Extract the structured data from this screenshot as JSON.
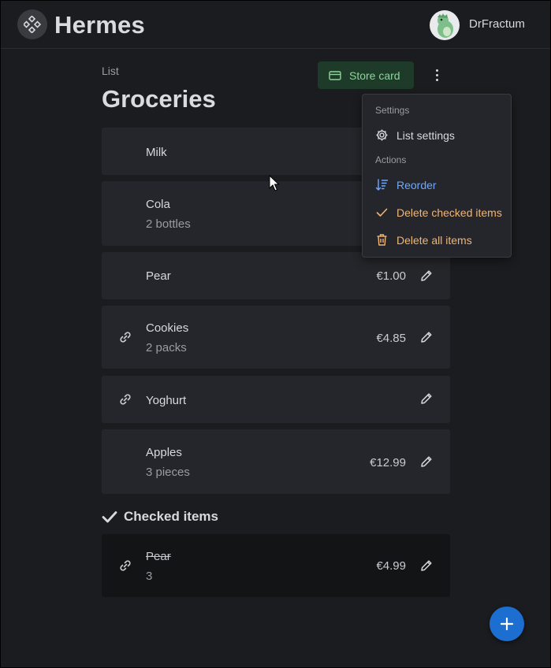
{
  "app": {
    "title": "Hermes",
    "username": "DrFractum"
  },
  "page": {
    "breadcrumb": "List",
    "title": "Groceries",
    "store_card_label": "Store card"
  },
  "menu": {
    "settings_header": "Settings",
    "list_settings": "List settings",
    "actions_header": "Actions",
    "reorder": "Reorder",
    "delete_checked": "Delete checked items",
    "delete_all": "Delete all items"
  },
  "items": [
    {
      "name": "Milk",
      "quantity": "",
      "price": "",
      "linked": false
    },
    {
      "name": "Cola",
      "quantity": "2 bottles",
      "price": "",
      "linked": false
    },
    {
      "name": "Pear",
      "quantity": "",
      "price": "€1.00",
      "linked": false
    },
    {
      "name": "Cookies",
      "quantity": "2 packs",
      "price": "€4.85",
      "linked": true
    },
    {
      "name": "Yoghurt",
      "quantity": "",
      "price": "",
      "linked": true
    },
    {
      "name": "Apples",
      "quantity": "3 pieces",
      "price": "€12.99",
      "linked": false
    }
  ],
  "checked_section": {
    "title": "Checked items"
  },
  "checked_items": [
    {
      "name": "Pear",
      "quantity": "3",
      "price": "€4.99",
      "linked": true
    }
  ],
  "colors": {
    "accent_blue": "#1c6fd1",
    "store_green": "#8fd39b",
    "menu_reorder": "#6ea8fe",
    "menu_delete": "#f0b575"
  },
  "icons": {
    "logo": "app-logo-icon",
    "store": "credit-card-icon",
    "more": "kebab-menu-icon",
    "settings": "gear-icon",
    "reorder": "sort-icon",
    "check": "check-icon",
    "trash": "trash-icon",
    "link": "link-icon",
    "edit": "pencil-icon",
    "add": "plus-icon"
  }
}
